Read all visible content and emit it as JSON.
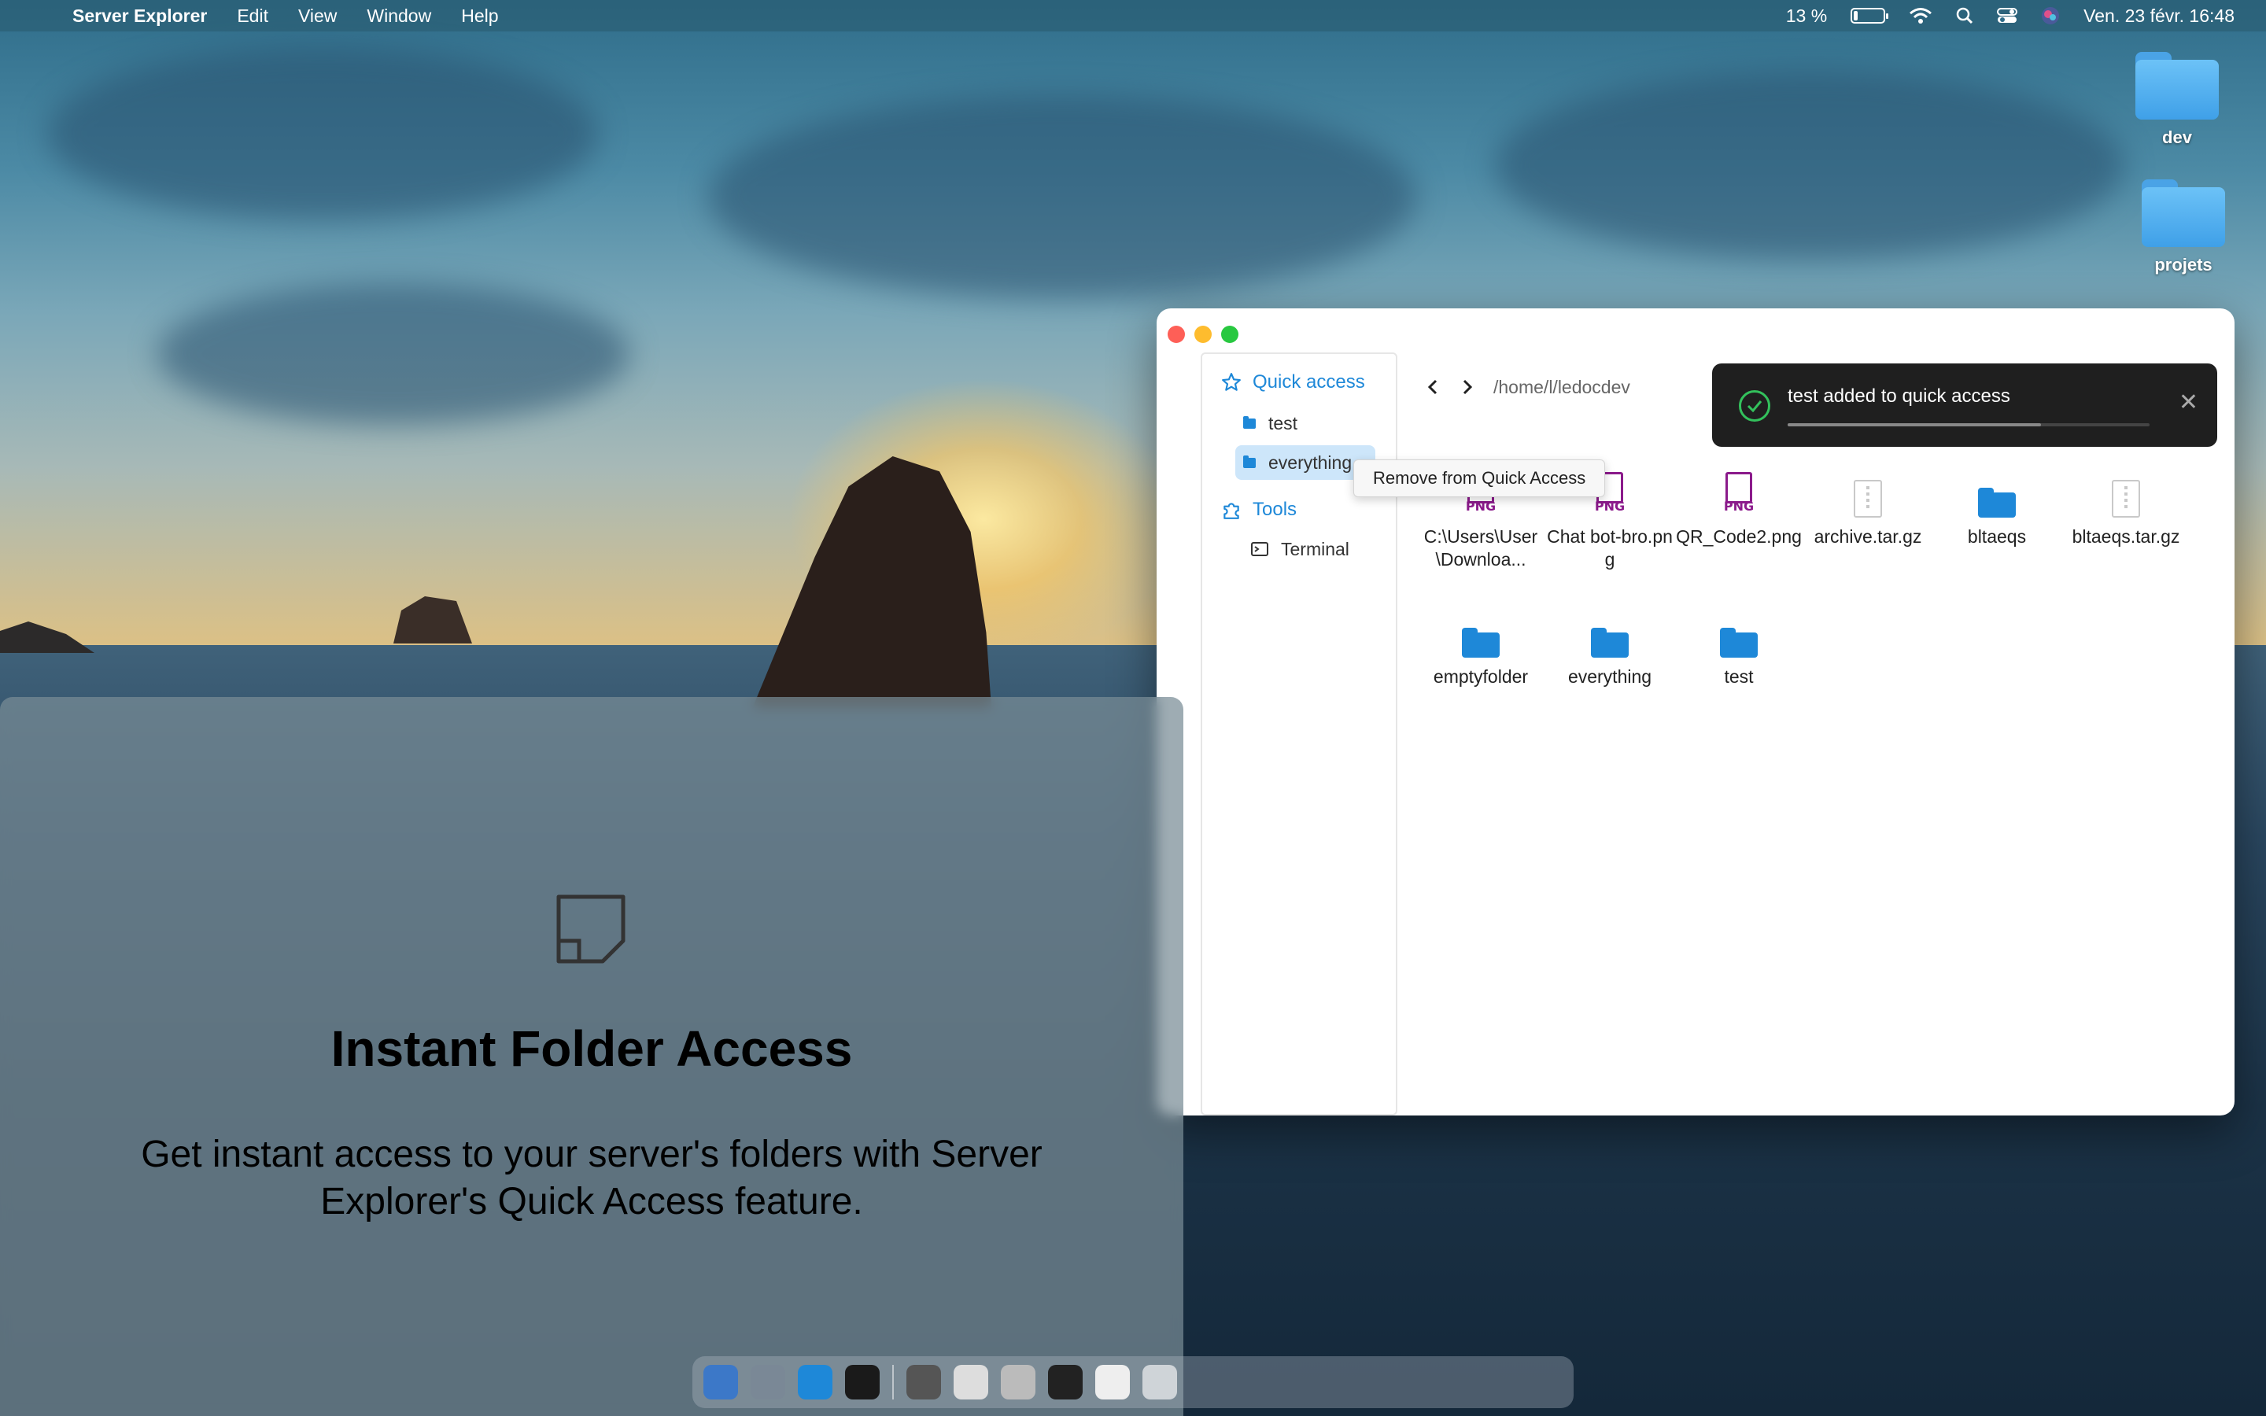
{
  "menubar": {
    "app_name": "Server Explorer",
    "menus": [
      "Edit",
      "View",
      "Window",
      "Help"
    ],
    "battery_percent": "13 %",
    "battery_level": 0.13,
    "datetime": "Ven. 23 févr. 16:48"
  },
  "desktop": {
    "icons": [
      {
        "label": "dev",
        "icon": "folder-icon"
      },
      {
        "label": "projets",
        "icon": "folder-icon"
      }
    ]
  },
  "window": {
    "sidebar": {
      "quick_access_label": "Quick access",
      "quick_items": [
        "test",
        "everything"
      ],
      "tools_label": "Tools",
      "tool_items": [
        "Terminal"
      ]
    },
    "nav": {
      "path": "/home/l/ledocdev"
    },
    "context_tooltip": "Remove from Quick Access",
    "toast": {
      "message": "test added to quick access",
      "progress": 0.7
    },
    "files": [
      {
        "name": "C:\\Users\\User\\Downloa...",
        "type": "png"
      },
      {
        "name": "Chat bot-bro.png",
        "type": "png"
      },
      {
        "name": "QR_Code2.png",
        "type": "png"
      },
      {
        "name": "archive.tar.gz",
        "type": "archive"
      },
      {
        "name": "bltaeqs",
        "type": "folder"
      },
      {
        "name": "bltaeqs.tar.gz",
        "type": "archive"
      },
      {
        "name": "emptyfolder",
        "type": "folder"
      },
      {
        "name": "everything",
        "type": "folder"
      },
      {
        "name": "test",
        "type": "folder"
      }
    ],
    "png_label": "PNG"
  },
  "promo": {
    "title": "Instant Folder Access",
    "description": "Get instant access to your server's  folders with Server Explorer's Quick Access feature."
  },
  "colors": {
    "accent": "#1e88d8",
    "png": "#8b1a8b",
    "toast_bg": "#1f1f1f",
    "success": "#33c15c"
  }
}
